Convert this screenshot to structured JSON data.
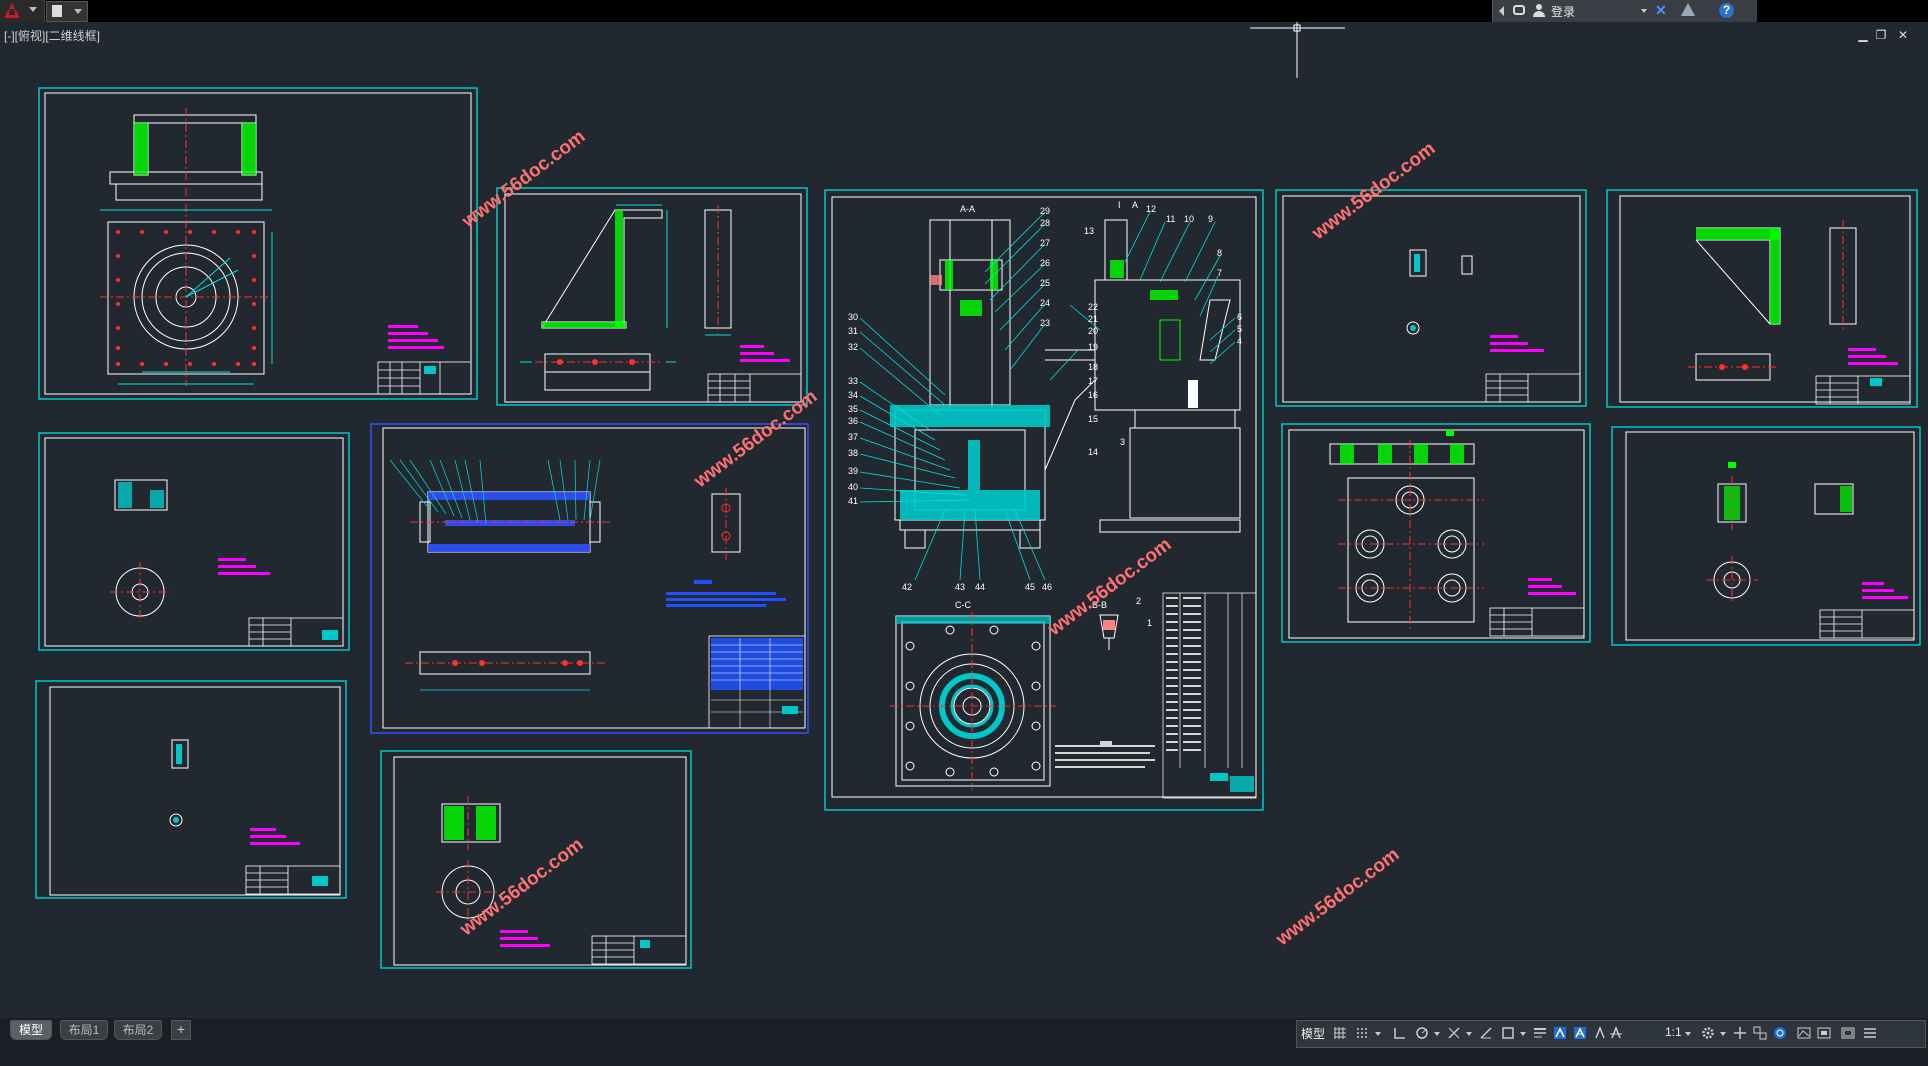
{
  "titlebar": {
    "login_label": "登录"
  },
  "viewport": {
    "view_label": "[-][俯视][二维线框]",
    "window_controls": [
      "minimize-icon",
      "restore-icon",
      "close-icon"
    ]
  },
  "watermarks": [
    "www.56doc.com",
    "www.56doc.com",
    "www.56doc.com",
    "www.56doc.com",
    "www.56doc.com",
    "www.56doc.com"
  ],
  "assembly": {
    "section_aa": "A-A",
    "section_cc": "C-C",
    "section_bb": "B-B",
    "view_i": "I",
    "view_a": "A",
    "balloons_right": [
      "12",
      "11",
      "10",
      "9",
      "8",
      "7",
      "6",
      "5",
      "4",
      "3",
      "2",
      "1"
    ],
    "balloons_top": [
      "29",
      "28",
      "27",
      "26",
      "25",
      "24",
      "23",
      "22",
      "21",
      "20",
      "19",
      "18",
      "17",
      "16",
      "15",
      "14",
      "13"
    ],
    "balloons_left": [
      "30",
      "31",
      "32",
      "33",
      "34",
      "35",
      "36",
      "37",
      "38",
      "39",
      "40",
      "41"
    ],
    "balloons_bottom": [
      "42",
      "43",
      "44",
      "45",
      "46"
    ]
  },
  "layout_tabs": [
    "模型",
    "布局1",
    "布局2"
  ],
  "statusbar": {
    "model_label": "模型",
    "scale_label": "1:1"
  },
  "colors": {
    "frame": "#00c8c8",
    "geometry": "#ffffff",
    "hatch": "#00ff00",
    "dimension": "#00e0e0",
    "centerline": "#ff3030",
    "notes": "#ff00ff",
    "watermark": "#ff7070",
    "table": "#1e50ff"
  }
}
